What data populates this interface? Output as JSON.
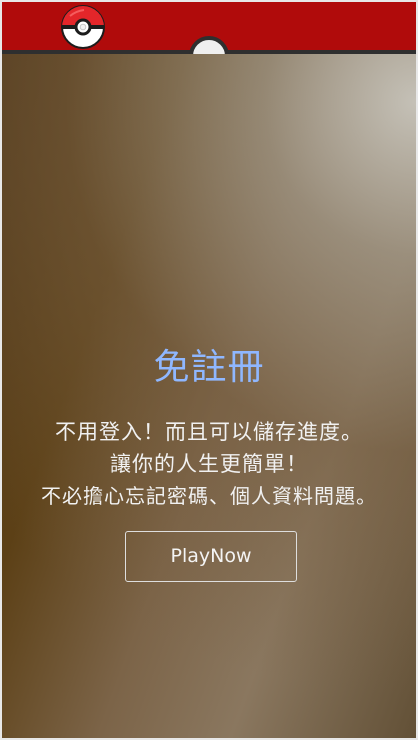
{
  "header": {
    "logo": "pokeball-icon",
    "center_button": "circle-button",
    "color": "#b00b0b"
  },
  "intro": {
    "title": "免註冊",
    "lines": [
      "不用登入！而且可以儲存進度。",
      "讓你的人生更簡單！",
      "不必擔心忘記密碼、個人資料問題。"
    ],
    "button_label": "PlayNow"
  }
}
